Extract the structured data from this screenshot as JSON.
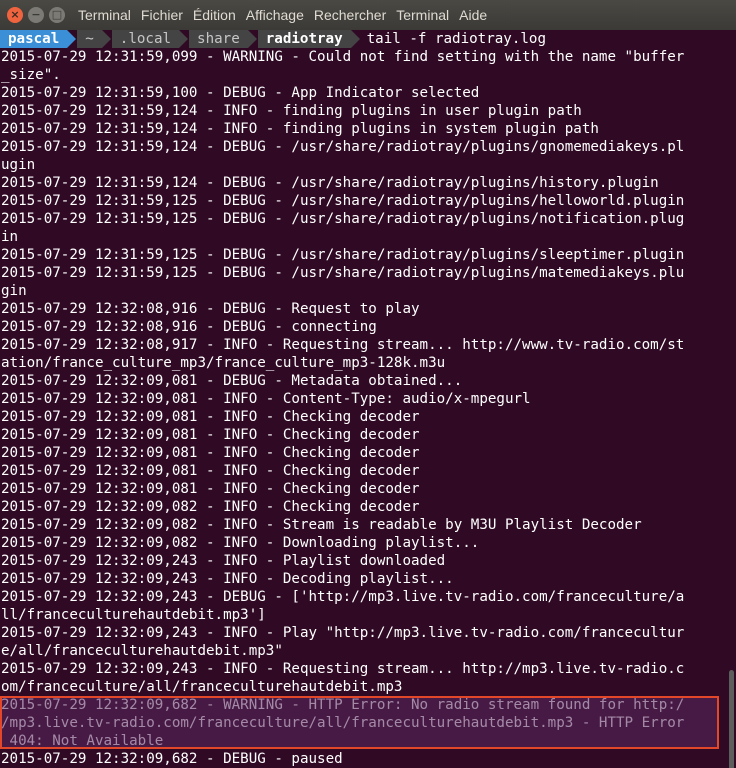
{
  "window": {
    "menu": [
      "Terminal",
      "Fichier",
      "Édition",
      "Affichage",
      "Rechercher",
      "Terminal",
      "Aide"
    ]
  },
  "prompt": {
    "user": "pascal",
    "segments": [
      "~",
      ".local",
      "share",
      "radiotray"
    ],
    "command": "tail -f radiotray.log"
  },
  "log_lines": [
    "2015-07-29 12:31:59,099 - WARNING - Could not find setting with the name \"buffer",
    "_size\".",
    "2015-07-29 12:31:59,100 - DEBUG - App Indicator selected",
    "2015-07-29 12:31:59,124 - INFO - finding plugins in user plugin path",
    "2015-07-29 12:31:59,124 - INFO - finding plugins in system plugin path",
    "2015-07-29 12:31:59,124 - DEBUG - /usr/share/radiotray/plugins/gnomemediakeys.pl",
    "ugin",
    "2015-07-29 12:31:59,124 - DEBUG - /usr/share/radiotray/plugins/history.plugin",
    "2015-07-29 12:31:59,125 - DEBUG - /usr/share/radiotray/plugins/helloworld.plugin",
    "2015-07-29 12:31:59,125 - DEBUG - /usr/share/radiotray/plugins/notification.plug",
    "in",
    "2015-07-29 12:31:59,125 - DEBUG - /usr/share/radiotray/plugins/sleeptimer.plugin",
    "2015-07-29 12:31:59,125 - DEBUG - /usr/share/radiotray/plugins/matemediakeys.plu",
    "gin",
    "2015-07-29 12:32:08,916 - DEBUG - Request to play",
    "2015-07-29 12:32:08,916 - DEBUG - connecting",
    "2015-07-29 12:32:08,917 - INFO - Requesting stream... http://www.tv-radio.com/st",
    "ation/france_culture_mp3/france_culture_mp3-128k.m3u",
    "2015-07-29 12:32:09,081 - DEBUG - Metadata obtained...",
    "2015-07-29 12:32:09,081 - INFO - Content-Type: audio/x-mpegurl",
    "2015-07-29 12:32:09,081 - INFO - Checking decoder",
    "2015-07-29 12:32:09,081 - INFO - Checking decoder",
    "2015-07-29 12:32:09,081 - INFO - Checking decoder",
    "2015-07-29 12:32:09,081 - INFO - Checking decoder",
    "2015-07-29 12:32:09,081 - INFO - Checking decoder",
    "2015-07-29 12:32:09,082 - INFO - Checking decoder",
    "2015-07-29 12:32:09,082 - INFO - Stream is readable by M3U Playlist Decoder",
    "2015-07-29 12:32:09,082 - INFO - Downloading playlist...",
    "2015-07-29 12:32:09,243 - INFO - Playlist downloaded",
    "2015-07-29 12:32:09,243 - INFO - Decoding playlist...",
    "2015-07-29 12:32:09,243 - DEBUG - ['http://mp3.live.tv-radio.com/franceculture/a",
    "ll/franceculturehautdebit.mp3']",
    "2015-07-29 12:32:09,243 - INFO - Play \"http://mp3.live.tv-radio.com/francecultur",
    "e/all/franceculturehautdebit.mp3\"",
    "2015-07-29 12:32:09,243 - INFO - Requesting stream... http://mp3.live.tv-radio.c",
    "om/franceculture/all/franceculturehautdebit.mp3",
    "2015-07-29 12:32:09,682 - WARNING - HTTP Error: No radio stream found for http:/",
    "/mp3.live.tv-radio.com/franceculture/all/franceculturehautdebit.mp3 - HTTP Error",
    " 404: Not Available",
    "2015-07-29 12:32:09,682 - DEBUG - paused"
  ],
  "highlight": {
    "label": "warning-highlight",
    "color": "#e3472a"
  },
  "colors": {
    "background": "#300a24",
    "user_segment": "#3a8fd6",
    "path_segment": "#444444"
  }
}
